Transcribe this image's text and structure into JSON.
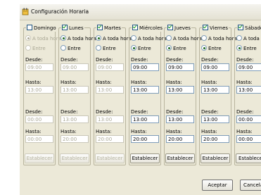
{
  "window": {
    "title": "Configuración Horaria"
  },
  "days": [
    {
      "name": "Domingo",
      "checked": false,
      "mode": "all",
      "enabled": false,
      "desde_label": "Desde:",
      "hasta_label": "Hasta:",
      "desde1": "09:00",
      "hasta1": "13:00",
      "desde2": "00:00",
      "hasta2": "00:00",
      "radio_all": "A toda hora",
      "radio_between": "Entre",
      "set_label": "Establecer"
    },
    {
      "name": "Lunes",
      "checked": true,
      "mode": "all",
      "enabled": false,
      "desde_label": "Desde:",
      "hasta_label": "Hasta:",
      "desde1": "09:00",
      "hasta1": "13:00",
      "desde2": "13:00",
      "hasta2": "20:00",
      "radio_all": "A toda hora",
      "radio_between": "Entre",
      "set_label": "Establecer"
    },
    {
      "name": "Martes",
      "checked": true,
      "mode": "all",
      "enabled": false,
      "desde_label": "Desde:",
      "hasta_label": "Hasta:",
      "desde1": "09:00",
      "hasta1": "13:00",
      "desde2": "13:00",
      "hasta2": "20:00",
      "radio_all": "A toda hora",
      "radio_between": "Entre",
      "set_label": "Establecer"
    },
    {
      "name": "Miércoles",
      "checked": true,
      "mode": "between",
      "enabled": true,
      "desde_label": "Desde:",
      "hasta_label": "Hasta:",
      "desde1": "09:00",
      "hasta1": "13:00",
      "desde2": "13:00",
      "hasta2": "20:00",
      "radio_all": "A toda hora",
      "radio_between": "Entre",
      "set_label": "Establecer"
    },
    {
      "name": "Jueves",
      "checked": true,
      "mode": "between",
      "enabled": true,
      "desde_label": "Desde:",
      "hasta_label": "Hasta:",
      "desde1": "09:00",
      "hasta1": "13:00",
      "desde2": "13:00",
      "hasta2": "20:00",
      "radio_all": "A toda hora",
      "radio_between": "Entre",
      "set_label": "Establecer"
    },
    {
      "name": "Viernes",
      "checked": true,
      "mode": "between",
      "enabled": true,
      "desde_label": "Desde:",
      "hasta_label": "Hasta:",
      "desde1": "09:00",
      "hasta1": "13:00",
      "desde2": "13:00",
      "hasta2": "20:00",
      "radio_all": "A toda hora",
      "radio_between": "Entre",
      "set_label": "Establecer"
    },
    {
      "name": "Sábado",
      "checked": true,
      "mode": "between",
      "enabled": true,
      "desde_label": "Desde:",
      "hasta_label": "Hasta:",
      "desde1": "09:00",
      "hasta1": "13:00",
      "desde2": "00:00",
      "hasta2": "00:00",
      "radio_all": "A toda ho",
      "radio_between": "Entre",
      "set_label": "Establece"
    }
  ],
  "footer": {
    "accept_label": "Aceptar",
    "cancel_label": "Cancela"
  }
}
